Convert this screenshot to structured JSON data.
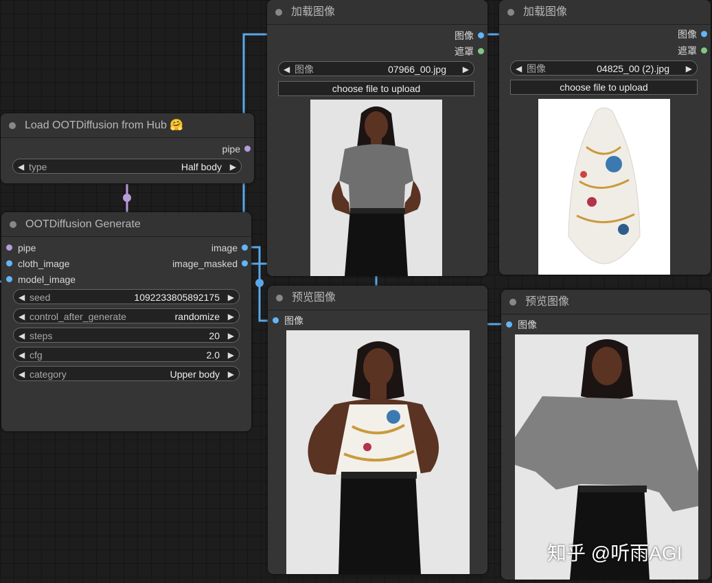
{
  "colors": {
    "link_image": "#5aa7e8",
    "link_pipe": "#b79cd9",
    "slot_image": "#64b5f6",
    "slot_mask": "#81c784",
    "slot_pipe": "#b39ddb"
  },
  "nodes": {
    "load_model": {
      "title": "Load OOTDiffusion from Hub",
      "title_emoji": "🤗",
      "outputs": [
        "pipe"
      ],
      "widgets": [
        {
          "label": "type",
          "value": "Half body"
        }
      ]
    },
    "generate": {
      "title": "OOTDiffusion Generate",
      "inputs": [
        "pipe",
        "cloth_image",
        "model_image"
      ],
      "outputs": [
        "image",
        "image_masked"
      ],
      "widgets": [
        {
          "label": "seed",
          "value": "1092233805892175"
        },
        {
          "label": "control_after_generate",
          "value": "randomize"
        },
        {
          "label": "steps",
          "value": "20"
        },
        {
          "label": "cfg",
          "value": "2.0"
        },
        {
          "label": "category",
          "value": "Upper body"
        }
      ]
    },
    "load_image_model": {
      "title": "加载图像",
      "outputs": [
        "图像",
        "遮罩"
      ],
      "widget": {
        "label": "图像",
        "value": "07966_00.jpg"
      },
      "upload_label": "choose file to upload"
    },
    "load_image_cloth": {
      "title": "加载图像",
      "outputs": [
        "图像",
        "遮罩"
      ],
      "widget": {
        "label": "图像",
        "value": "04825_00 (2).jpg"
      },
      "upload_label": "choose file to upload"
    },
    "preview_result": {
      "title": "预览图像",
      "inputs": [
        "图像"
      ]
    },
    "preview_mask": {
      "title": "预览图像",
      "inputs": [
        "图像"
      ]
    }
  },
  "watermark": "知乎 @听雨AGI"
}
